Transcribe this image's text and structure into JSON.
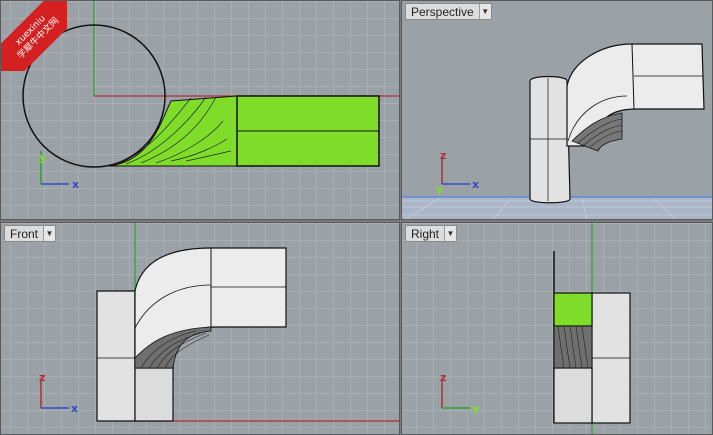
{
  "watermark": {
    "line1": "xuexiniu",
    "line2": "学犀牛中文网"
  },
  "viewports": {
    "top": {
      "axes": {
        "x": "x",
        "y": "y"
      }
    },
    "perspective": {
      "title": "Perspective",
      "axes": {
        "z": "z",
        "x": "x",
        "y": "y"
      }
    },
    "front": {
      "title": "Front",
      "axes": {
        "z": "z",
        "x": "x"
      }
    },
    "right": {
      "title": "Right",
      "axes": {
        "z": "z",
        "y": "y"
      }
    }
  },
  "colors": {
    "grid_bg": "#9aa2a8",
    "grid_line": "#b4bbc0",
    "x_axis": "#b03030",
    "y_axis": "#30a030",
    "z_axis": "#3050c0",
    "selected_surface": "#7fdd2a",
    "surface": "#e6e6e6"
  },
  "dropdown_icon": "chevron-down-icon"
}
